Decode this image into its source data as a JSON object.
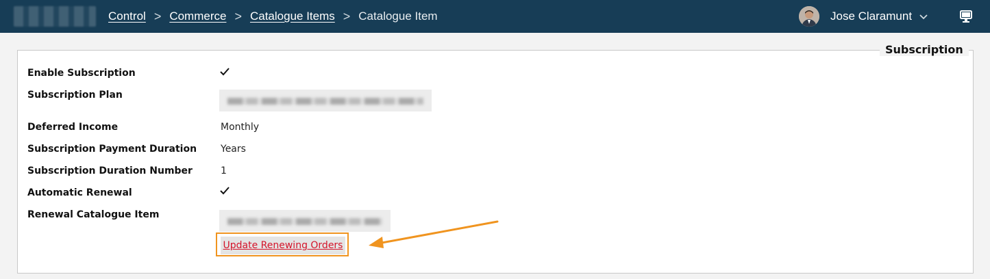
{
  "breadcrumb": {
    "items": [
      "Control",
      "Commerce",
      "Catalogue Items"
    ],
    "current": "Catalogue Item",
    "separator": ">"
  },
  "user": {
    "name": "Jose Claramunt",
    "icons": [
      "avatar",
      "chevron-down-icon",
      "monitor-icon"
    ]
  },
  "section": {
    "title": "Subscription",
    "fields": {
      "enable_subscription": {
        "label": "Enable Subscription",
        "value": "checked"
      },
      "subscription_plan": {
        "label": "Subscription Plan",
        "value": "(blurred)"
      },
      "deferred_income": {
        "label": "Deferred Income",
        "value": "Monthly"
      },
      "payment_duration": {
        "label": "Subscription Payment Duration",
        "value": "Years"
      },
      "duration_number": {
        "label": "Subscription Duration Number",
        "value": "1"
      },
      "automatic_renewal": {
        "label": "Automatic Renewal",
        "value": "checked"
      },
      "renewal_item": {
        "label": "Renewal Catalogue Item",
        "value": "(blurred)"
      }
    },
    "update_button": "Update Renewing Orders"
  },
  "colors": {
    "topbar": "#173d56",
    "link_red": "#d4142a",
    "highlight_orange": "#f0941f"
  }
}
